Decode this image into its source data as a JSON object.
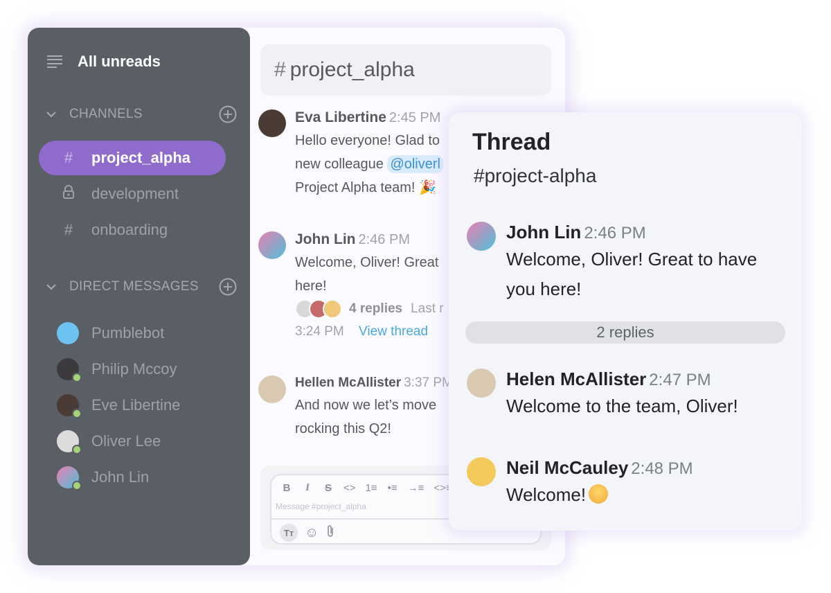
{
  "sidebar": {
    "all_unreads": "All unreads",
    "channels_title": "CHANNELS",
    "channels": [
      {
        "name": "project_alpha",
        "icon": "hash-icon",
        "glyph": "#",
        "active": true
      },
      {
        "name": "development",
        "icon": "lock-icon",
        "glyph": "🔒",
        "active": false
      },
      {
        "name": "onboarding",
        "icon": "hash-icon",
        "glyph": "#",
        "active": false
      }
    ],
    "dms_title": "DIRECT MESSAGES",
    "dms": [
      {
        "name": "Pumblebot",
        "online": false,
        "color": "#6cc3f2"
      },
      {
        "name": "Philip Mccoy",
        "online": true,
        "color": "#3c3a3c"
      },
      {
        "name": "Eve Libertine",
        "online": true,
        "color": "#4a3b35"
      },
      {
        "name": "Oliver Lee",
        "online": true,
        "color": "#dcdcdc"
      },
      {
        "name": "John Lin",
        "online": true,
        "color": "#e97fb3"
      }
    ]
  },
  "channel": {
    "hash": "#",
    "name": "project_alpha",
    "messages": [
      {
        "author": "Eva Libertine",
        "time": "2:45 PM",
        "lines": [
          "Hello everyone! Glad to",
          "new colleague",
          "Project Alpha team! 🎉"
        ],
        "mention": "@oliverl"
      },
      {
        "author": "John Lin",
        "time": "2:46 PM",
        "lines": [
          "Welcome, Oliver! Great",
          "here!"
        ],
        "replies": "4 replies",
        "last_reply": "Last r",
        "last_time": "3:24 PM",
        "view_thread": "View thread"
      },
      {
        "author": "Hellen McAllister",
        "time": "3:37 PM",
        "lines": [
          "And now we let’s move",
          "rocking this Q2!"
        ]
      }
    ],
    "composer": {
      "placeholder": "Message #project_alpha",
      "toolbar": [
        "B",
        "I",
        "S",
        "<>",
        "1≡",
        "•≡",
        "→≡",
        "<>≡"
      ],
      "text_format": "Tт",
      "emoji": "☺",
      "attach": "📎"
    }
  },
  "thread": {
    "title": "Thread",
    "channel": "#project-alpha",
    "parent": {
      "author": "John Lin",
      "time": "2:46 PM",
      "lines": [
        "Welcome, Oliver! Great to have",
        "you here!"
      ]
    },
    "replies_label": "2 replies",
    "replies": [
      {
        "author": "Helen McAllister",
        "time": "2:47 PM",
        "text": "Welcome to the team, Oliver!"
      },
      {
        "author": "Neil McCauley",
        "time": "2:48 PM",
        "text": "Welcome!"
      }
    ]
  },
  "colors": {
    "sidebar_bg": "#5a5f66",
    "active_channel": "#8f6bcc",
    "link": "#4aa8dd",
    "online": "#a6d47a"
  }
}
